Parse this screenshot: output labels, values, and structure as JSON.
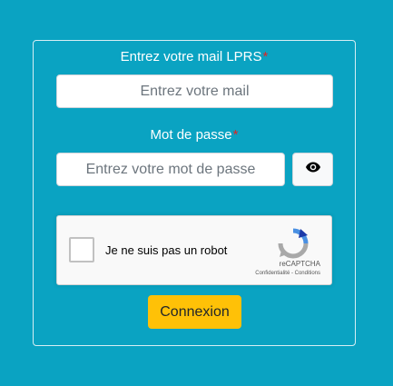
{
  "form": {
    "email_label": "Entrez votre mail LPRS",
    "email_placeholder": "Entrez votre mail",
    "email_value": "",
    "password_label": "Mot de passe",
    "password_placeholder": "Entrez votre mot de passe",
    "password_value": "",
    "required_marker": "*",
    "toggle_icon": "eye-icon",
    "submit_label": "Connexion"
  },
  "recaptcha": {
    "checkbox_label": "Je ne suis pas un robot",
    "checked": false,
    "brand": "reCAPTCHA",
    "privacy_link": "Confidentialité",
    "separator": " - ",
    "terms_link": "Conditions"
  },
  "colors": {
    "background": "#0aa3c2",
    "submit_button": "#ffc107",
    "required_marker": "#e02424"
  }
}
